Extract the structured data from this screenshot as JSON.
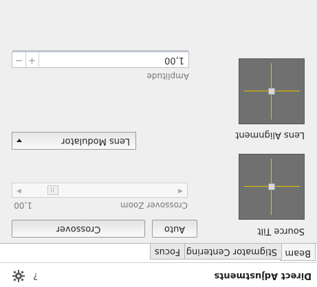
{
  "window": {
    "title": "Direct Adjustments",
    "help_label": "?"
  },
  "tabs": [
    {
      "label": "Beam",
      "active": true
    },
    {
      "label": "Stigmator Centering",
      "active": false
    },
    {
      "label": "Focus",
      "active": false
    }
  ],
  "source_tilt": {
    "label": "Source Tilt",
    "auto_label": "Auto",
    "crossover_label": "Crossover",
    "zoom_label": "Crossover Zoom",
    "zoom_value": "1,00",
    "zoom_level": 0.15
  },
  "lens_alignment": {
    "label": "Lens Alignment",
    "modulator_label": "Lens Modulator",
    "amplitude_label": "Amplitude",
    "amplitude_value": "1,00",
    "minus_label": "−",
    "plus_label": "+"
  },
  "colors": {
    "crosshair": "#e6c000",
    "pad": "#707070",
    "accent_bar": "#c0c8d6"
  },
  "icons": [
    "gear-icon",
    "help-icon",
    "chevron-down-icon",
    "arrow-left-icon",
    "arrow-right-icon"
  ]
}
